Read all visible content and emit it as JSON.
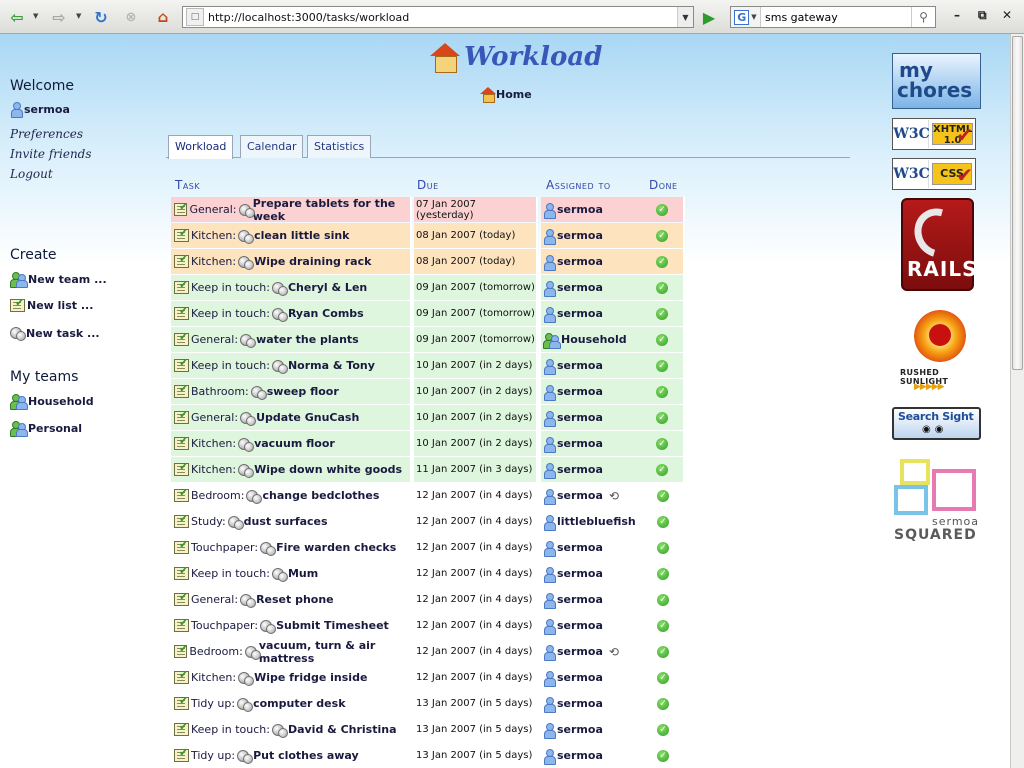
{
  "browser": {
    "url": "http://localhost:3000/tasks/workload",
    "search_value": "sms gateway",
    "search_engine_letter": "G"
  },
  "page": {
    "title": "Workload",
    "home_label": "Home"
  },
  "sidebar": {
    "welcome_heading": "Welcome",
    "user": "sermoa",
    "links": [
      "Preferences",
      "Invite friends",
      "Logout"
    ],
    "create_heading": "Create",
    "create_items": [
      "New team ...",
      "New list ...",
      "New task ..."
    ],
    "teams_heading": "My teams",
    "teams": [
      "Household",
      "Personal"
    ]
  },
  "tabs": [
    "Workload",
    "Calendar",
    "Statistics"
  ],
  "table": {
    "headers": [
      "Task",
      "Due",
      "Assigned to",
      "Done"
    ],
    "rows": [
      {
        "category": "General:",
        "task": "Prepare tablets for the week",
        "due": "07 Jan 2007 (yesterday)",
        "assigned": "sermoa",
        "assignee_type": "user",
        "status": "overdue",
        "recurring": false
      },
      {
        "category": "Kitchen:",
        "task": "clean little sink",
        "due": "08 Jan 2007 (today)",
        "assigned": "sermoa",
        "assignee_type": "user",
        "status": "today",
        "recurring": false
      },
      {
        "category": "Kitchen:",
        "task": "Wipe draining rack",
        "due": "08 Jan 2007 (today)",
        "assigned": "sermoa",
        "assignee_type": "user",
        "status": "today",
        "recurring": false
      },
      {
        "category": "Keep in touch:",
        "task": "Cheryl & Len",
        "due": "09 Jan 2007 (tomorrow)",
        "assigned": "sermoa",
        "assignee_type": "user",
        "status": "soon",
        "recurring": false
      },
      {
        "category": "Keep in touch:",
        "task": "Ryan Combs",
        "due": "09 Jan 2007 (tomorrow)",
        "assigned": "sermoa",
        "assignee_type": "user",
        "status": "soon",
        "recurring": false
      },
      {
        "category": "General:",
        "task": "water the plants",
        "due": "09 Jan 2007 (tomorrow)",
        "assigned": "Household",
        "assignee_type": "team",
        "status": "soon",
        "recurring": false
      },
      {
        "category": "Keep in touch:",
        "task": "Norma & Tony",
        "due": "10 Jan 2007 (in 2 days)",
        "assigned": "sermoa",
        "assignee_type": "user",
        "status": "soon",
        "recurring": false
      },
      {
        "category": "Bathroom:",
        "task": "sweep floor",
        "due": "10 Jan 2007 (in 2 days)",
        "assigned": "sermoa",
        "assignee_type": "user",
        "status": "soon",
        "recurring": false
      },
      {
        "category": "General:",
        "task": "Update GnuCash",
        "due": "10 Jan 2007 (in 2 days)",
        "assigned": "sermoa",
        "assignee_type": "user",
        "status": "soon",
        "recurring": false
      },
      {
        "category": "Kitchen:",
        "task": "vacuum floor",
        "due": "10 Jan 2007 (in 2 days)",
        "assigned": "sermoa",
        "assignee_type": "user",
        "status": "soon",
        "recurring": false
      },
      {
        "category": "Kitchen:",
        "task": "Wipe down white goods",
        "due": "11 Jan 2007 (in 3 days)",
        "assigned": "sermoa",
        "assignee_type": "user",
        "status": "soon",
        "recurring": false
      },
      {
        "category": "Bedroom:",
        "task": "change bedclothes",
        "due": "12 Jan 2007 (in 4 days)",
        "assigned": "sermoa",
        "assignee_type": "user",
        "status": "later",
        "recurring": true
      },
      {
        "category": "Study:",
        "task": "dust surfaces",
        "due": "12 Jan 2007 (in 4 days)",
        "assigned": "littlebluefish",
        "assignee_type": "user",
        "status": "later",
        "recurring": false
      },
      {
        "category": "Touchpaper:",
        "task": "Fire warden checks",
        "due": "12 Jan 2007 (in 4 days)",
        "assigned": "sermoa",
        "assignee_type": "user",
        "status": "later",
        "recurring": false
      },
      {
        "category": "Keep in touch:",
        "task": "Mum",
        "due": "12 Jan 2007 (in 4 days)",
        "assigned": "sermoa",
        "assignee_type": "user",
        "status": "later",
        "recurring": false
      },
      {
        "category": "General:",
        "task": "Reset phone",
        "due": "12 Jan 2007 (in 4 days)",
        "assigned": "sermoa",
        "assignee_type": "user",
        "status": "later",
        "recurring": false
      },
      {
        "category": "Touchpaper:",
        "task": "Submit Timesheet",
        "due": "12 Jan 2007 (in 4 days)",
        "assigned": "sermoa",
        "assignee_type": "user",
        "status": "later",
        "recurring": false
      },
      {
        "category": "Bedroom:",
        "task": "vacuum, turn & air mattress",
        "due": "12 Jan 2007 (in 4 days)",
        "assigned": "sermoa",
        "assignee_type": "user",
        "status": "later",
        "recurring": true
      },
      {
        "category": "Kitchen:",
        "task": "Wipe fridge inside",
        "due": "12 Jan 2007 (in 4 days)",
        "assigned": "sermoa",
        "assignee_type": "user",
        "status": "later",
        "recurring": false
      },
      {
        "category": "Tidy up:",
        "task": "computer desk",
        "due": "13 Jan 2007 (in 5 days)",
        "assigned": "sermoa",
        "assignee_type": "user",
        "status": "later",
        "recurring": false
      },
      {
        "category": "Keep in touch:",
        "task": "David & Christina",
        "due": "13 Jan 2007 (in 5 days)",
        "assigned": "sermoa",
        "assignee_type": "user",
        "status": "later",
        "recurring": false
      },
      {
        "category": "Tidy up:",
        "task": "Put clothes away",
        "due": "13 Jan 2007 (in 5 days)",
        "assigned": "sermoa",
        "assignee_type": "user",
        "status": "later",
        "recurring": false
      }
    ]
  },
  "colors": {
    "overdue": "#fbd1d1",
    "today": "#fde4bf",
    "soon": "#def6dd",
    "title": "#3a56b8"
  },
  "badges": {
    "mychores": [
      "my",
      "chores"
    ],
    "xhtml": "XHTML 1.0",
    "css": "CSS",
    "w3c": "W3C",
    "rails": "RAILS",
    "sunlight": "RUSHED SUNLIGHT",
    "search_sight": "Search Sight",
    "squared_name": "sermoa",
    "squared_label": "SQUARED"
  }
}
